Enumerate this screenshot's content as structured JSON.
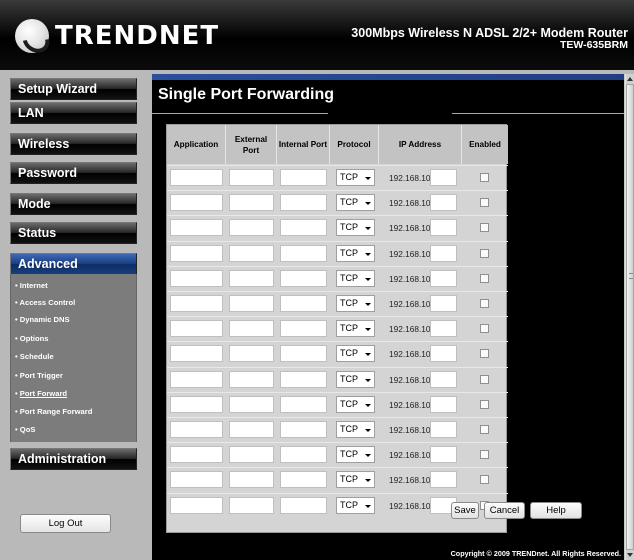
{
  "header": {
    "logo_text": "TRENDNET",
    "product_line1": "300Mbps Wireless N ADSL 2/2+ Modem Router",
    "product_line2": "TEW-635BRM"
  },
  "sidebar": {
    "items": [
      {
        "label": "Setup Wizard"
      },
      {
        "label": "LAN"
      },
      {
        "label": "Wireless"
      },
      {
        "label": "Password"
      },
      {
        "label": "Mode"
      },
      {
        "label": "Status"
      },
      {
        "label": "Advanced"
      },
      {
        "label": "Administration"
      }
    ],
    "submenu": [
      {
        "label": "Internet"
      },
      {
        "label": "Access Control"
      },
      {
        "label": "Dynamic DNS"
      },
      {
        "label": "Options"
      },
      {
        "label": "Schedule"
      },
      {
        "label": "Port Trigger"
      },
      {
        "label": "Port Forward"
      },
      {
        "label": "Port Range Forward"
      },
      {
        "label": "QoS"
      }
    ],
    "logout_label": "Log Out"
  },
  "main": {
    "title": "Single Port Forwarding",
    "columns": [
      "Application",
      "External Port",
      "Internal Port",
      "Protocol",
      "IP Address",
      "Enabled"
    ],
    "rows": [
      {
        "protocol": "TCP",
        "ip_prefix": "192.168.10."
      },
      {
        "protocol": "TCP",
        "ip_prefix": "192.168.10."
      },
      {
        "protocol": "TCP",
        "ip_prefix": "192.168.10."
      },
      {
        "protocol": "TCP",
        "ip_prefix": "192.168.10."
      },
      {
        "protocol": "TCP",
        "ip_prefix": "192.168.10."
      },
      {
        "protocol": "TCP",
        "ip_prefix": "192.168.10."
      },
      {
        "protocol": "TCP",
        "ip_prefix": "192.168.10."
      },
      {
        "protocol": "TCP",
        "ip_prefix": "192.168.10."
      },
      {
        "protocol": "TCP",
        "ip_prefix": "192.168.10."
      },
      {
        "protocol": "TCP",
        "ip_prefix": "192.168.10."
      },
      {
        "protocol": "TCP",
        "ip_prefix": "192.168.10."
      },
      {
        "protocol": "TCP",
        "ip_prefix": "192.168.10."
      },
      {
        "protocol": "TCP",
        "ip_prefix": "192.168.10."
      },
      {
        "protocol": "TCP",
        "ip_prefix": "192.168.10."
      }
    ],
    "buttons": {
      "save": "Save",
      "cancel": "Cancel",
      "help": "Help"
    }
  },
  "footer": {
    "copyright": "Copyright © 2009 TRENDnet. All Rights Reserved."
  },
  "colors": {
    "active_nav": "#1b3f83",
    "main_bg": "#000000",
    "table_bg": "#d4d4d4"
  }
}
